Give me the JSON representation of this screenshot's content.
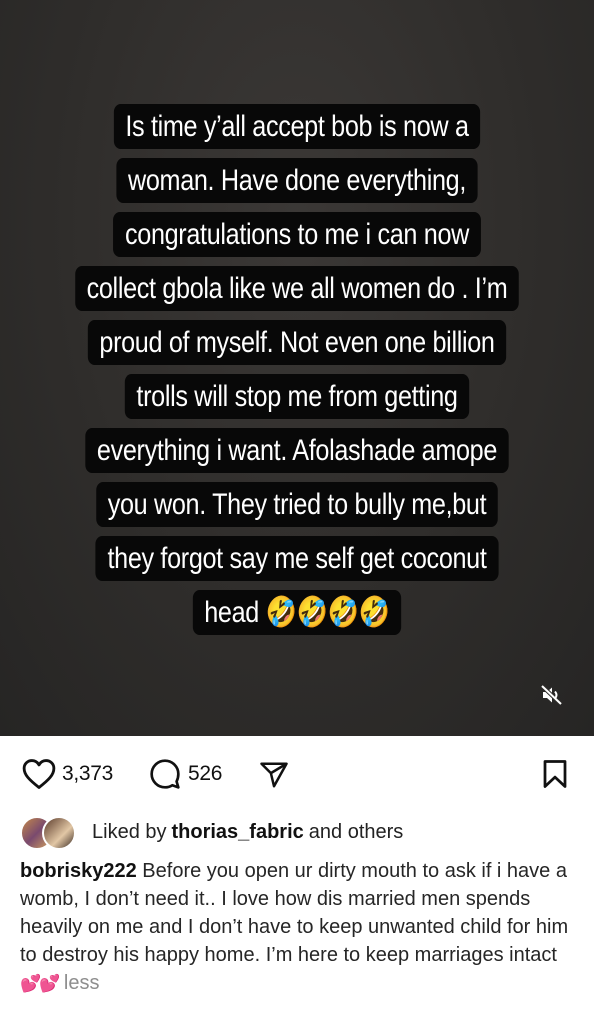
{
  "story": {
    "lines": [
      "Is time y’all accept bob is now a",
      "woman. Have done everything,",
      "congratulations to me i can now",
      "collect gbola like we all women do . I’m",
      "proud of myself. Not even one billion",
      "trolls will stop me from getting",
      "everything i want. Afolashade amope",
      "you won. They tried to bully me,but",
      "they forgot say me self get coconut",
      "head 🤣🤣🤣🤣"
    ]
  },
  "media": {
    "mute_icon": "speaker-muted-icon"
  },
  "actions": {
    "likes": "3,373",
    "comments": "526",
    "icons": [
      "heart-icon",
      "comment-icon",
      "share-icon",
      "bookmark-icon"
    ]
  },
  "liked_by": {
    "prefix": "Liked by",
    "user": "thorias_fabric",
    "suffix": "and others"
  },
  "caption": {
    "username": "bobrisky222",
    "text": "Before you open ur dirty mouth to ask if i have a womb, I don’t need it.. I love how dis married men spends heavily on me and I don’t have to keep unwanted child for him to destroy his happy home. I’m here to keep marriages intact",
    "emoji": "💕💕",
    "more": "less"
  }
}
